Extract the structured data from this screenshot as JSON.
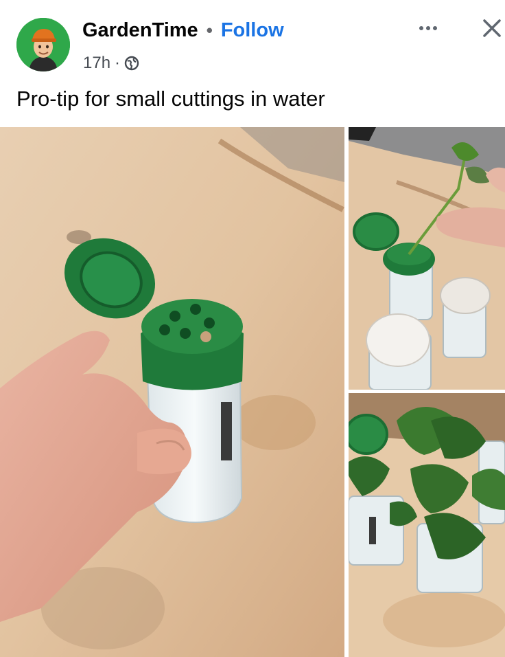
{
  "post": {
    "author": "GardenTime",
    "separator": "•",
    "follow_label": "Follow",
    "timestamp": "17h",
    "meta_separator": "·",
    "privacy_icon": "globe-icon",
    "more_icon": "more-icon",
    "close_icon": "close-icon",
    "caption": "Pro-tip for small cuttings in water"
  },
  "avatar": {
    "icon": "bitmoji-avatar",
    "bg": "#2fa84a"
  },
  "photos": [
    {
      "name": "spice-shaker-in-hand"
    },
    {
      "name": "cutting-inserted-in-shaker"
    },
    {
      "name": "cuttings-growing-in-shakers"
    }
  ],
  "colors": {
    "link": "#1b74e4",
    "lid_green": "#1f7a3a",
    "table": "#e0c4a4"
  }
}
